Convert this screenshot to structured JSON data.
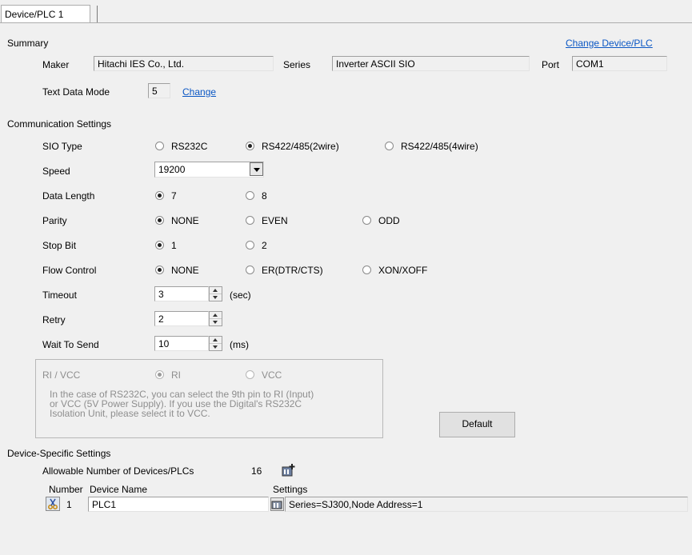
{
  "tab": {
    "label": "Device/PLC 1"
  },
  "summary": {
    "heading": "Summary",
    "change_device_link": "Change Device/PLC",
    "maker_label": "Maker",
    "maker_value": "Hitachi IES Co., Ltd.",
    "series_label": "Series",
    "series_value": "Inverter ASCII SIO",
    "port_label": "Port",
    "port_value": "COM1",
    "text_mode_label": "Text Data Mode",
    "text_mode_value": "5",
    "change_link": "Change"
  },
  "comm": {
    "heading": "Communication Settings",
    "sio_type_label": "SIO Type",
    "sio_options": [
      "RS232C",
      "RS422/485(2wire)",
      "RS422/485(4wire)"
    ],
    "sio_selected": "RS422/485(2wire)",
    "speed_label": "Speed",
    "speed_value": "19200",
    "data_length_label": "Data Length",
    "data_length_options": [
      "7",
      "8"
    ],
    "data_length_selected": "7",
    "parity_label": "Parity",
    "parity_options": [
      "NONE",
      "EVEN",
      "ODD"
    ],
    "parity_selected": "NONE",
    "stop_bit_label": "Stop Bit",
    "stop_bit_options": [
      "1",
      "2"
    ],
    "stop_bit_selected": "1",
    "flow_control_label": "Flow Control",
    "flow_control_options": [
      "NONE",
      "ER(DTR/CTS)",
      "XON/XOFF"
    ],
    "flow_control_selected": "NONE",
    "timeout_label": "Timeout",
    "timeout_value": "3",
    "timeout_unit": "(sec)",
    "retry_label": "Retry",
    "retry_value": "2",
    "wait_label": "Wait To Send",
    "wait_value": "10",
    "wait_unit": "(ms)",
    "ri_vcc_label": "RI / VCC",
    "ri_option": "RI",
    "vcc_option": "VCC",
    "ri_vcc_selected": "RI",
    "ri_note_line1": "In the case of RS232C, you can select the 9th pin to RI (Input)",
    "ri_note_line2": "or VCC (5V Power Supply). If you use the Digital's RS232C",
    "ri_note_line3": "Isolation Unit, please select it to VCC.",
    "default_button": "Default"
  },
  "device": {
    "heading": "Device-Specific Settings",
    "allowable_label": "Allowable Number of Devices/PLCs",
    "allowable_value": "16",
    "col_number": "Number",
    "col_device_name": "Device Name",
    "col_settings": "Settings",
    "row_number": "1",
    "row_device_name": "PLC1",
    "row_settings": "Series=SJ300,Node Address=1"
  },
  "colors": {
    "link": "#0b57c4",
    "disabled_text": "#8e8e8e",
    "background": "#f0f0f0"
  },
  "icons": [
    "add-device-icon",
    "settings-icon",
    "delete-icon"
  ]
}
